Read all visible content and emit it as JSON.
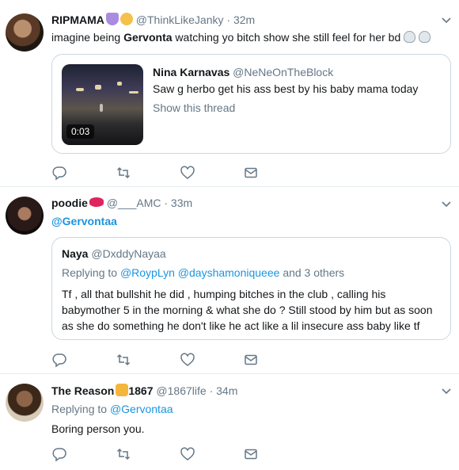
{
  "tweets": [
    {
      "name": "RIPMAMA",
      "handle": "@ThinkLikeJanky",
      "time": "32m",
      "text_pre": "imagine being ",
      "text_bold": "Gervonta",
      "text_post": " watching yo bitch show she still feel for her bd",
      "card": {
        "name": "Nina Karnavas",
        "handle": "@NeNeOnTheBlock",
        "text": "Saw g herbo get his ass best by his baby mama today",
        "link": "Show this thread",
        "duration": "0:03"
      }
    },
    {
      "name": "poodie",
      "handle": "@___AMC",
      "time": "33m",
      "mention": "@Gervontaa",
      "quote": {
        "name": "Naya",
        "handle": "@DxddyNayaa",
        "replying_label": "Replying to",
        "replying_1": "@RoypLyn",
        "replying_2": "@dayshamoniqueee",
        "replying_more": "and 3 others",
        "text": "Tf , all that bullshit he did , humping bitches in the club , calling his babymother 5 in the morning & what she do ? Still stood by him but as soon as she do something he don't like he act like a lil insecure ass baby like tf"
      }
    },
    {
      "name": "The Reason",
      "name_suffix": "1867",
      "handle": "@1867life",
      "time": "34m",
      "replying_label": "Replying to",
      "replying_to": "@Gervontaa",
      "text": "Boring person you."
    }
  ],
  "separator": "·",
  "icons": {
    "reply": "reply-icon",
    "retweet": "retweet-icon",
    "like": "heart-icon",
    "dm": "envelope-icon",
    "caret": "chevron-down-icon"
  },
  "colors": {
    "link": "#1b95e0",
    "muted": "#657786",
    "border": "#e6ecf0"
  }
}
